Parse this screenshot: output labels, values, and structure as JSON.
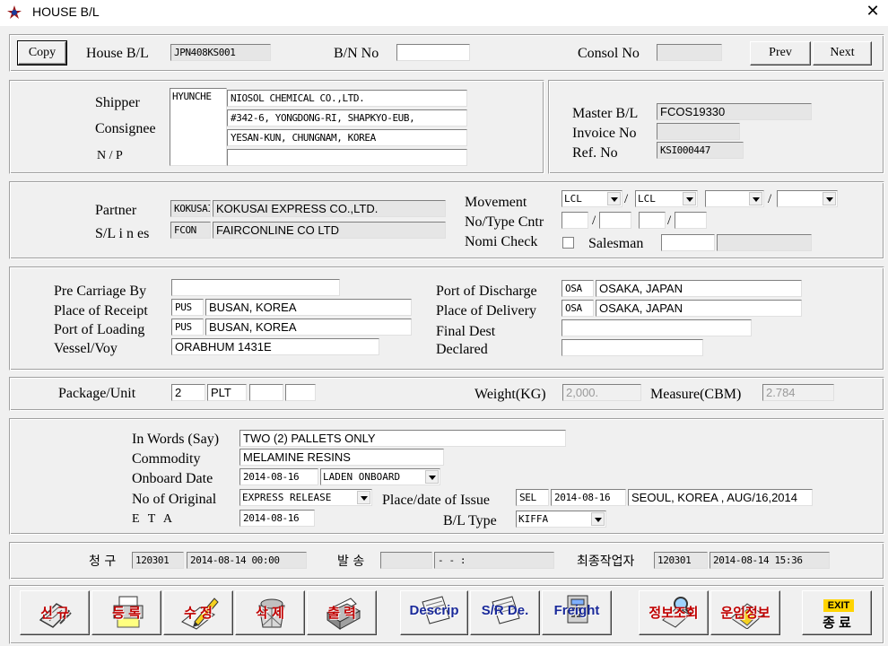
{
  "window": {
    "title": "HOUSE B/L",
    "close_glyph": "✕",
    "app_icon": "app-icon"
  },
  "header": {
    "copy_label": "Copy",
    "house_bl_label": "House B/L",
    "house_bl_value": "JPN408KS001",
    "bn_label": "B/N No",
    "bn_value": "",
    "consol_label": "Consol No",
    "consol_value": "",
    "prev_label": "Prev",
    "next_label": "Next"
  },
  "parties": {
    "shipper_label": "Shipper",
    "consignee_label": "Consignee",
    "np_label": "N / P",
    "shipper_code": "HYUNCHE",
    "lines": [
      "NIOSOL CHEMICAL CO.,LTD.",
      "#342-6, YONGDONG-RI, SHAPKYO-EUB,",
      "YESAN-KUN, CHUNGNAM, KOREA",
      ""
    ],
    "master_bl_label": "Master B/L",
    "master_bl_value": "FCOS19330",
    "invoice_label": "Invoice No",
    "invoice_value": "",
    "ref_label": "Ref. No",
    "ref_value": "KSI000447"
  },
  "partner": {
    "partner_label": "Partner",
    "partner_code": "KOKUSAI",
    "partner_name": "KOKUSAI EXPRESS CO.,LTD.",
    "sl_label": "S/L i n es",
    "sl_code": "FCON",
    "sl_name": "FAIRCONLINE CO LTD",
    "movement_label": "Movement",
    "movement_1": "LCL",
    "movement_2": "LCL",
    "movement_3": "",
    "movement_4": "",
    "sep": "/",
    "cntr_label": "No/Type Cntr",
    "nomi_label": "Nomi Check",
    "salesman_label": "Salesman",
    "salesman_code": "",
    "salesman_name": ""
  },
  "routing": {
    "pre_carriage_label": "Pre Carriage By",
    "pre_carriage_value": "",
    "receipt_label": "Place of Receipt",
    "receipt_code": "PUS",
    "receipt_name": "BUSAN, KOREA",
    "loading_label": "Port of Loading",
    "loading_code": "PUS",
    "loading_name": "BUSAN, KOREA",
    "vessel_label": "Vessel/Voy",
    "vessel_value": "ORABHUM  1431E",
    "discharge_label": "Port of Discharge",
    "discharge_code": "OSA",
    "discharge_name": "OSAKA, JAPAN",
    "delivery_label": "Place of Delivery",
    "delivery_code": "OSA",
    "delivery_name": "OSAKA, JAPAN",
    "final_dest_label": "Final Dest",
    "final_dest_value": "",
    "declared_label": "Declared",
    "declared_value": ""
  },
  "cargo": {
    "package_label": "Package/Unit",
    "package_qty": "2",
    "package_unit": "PLT",
    "package_x1": "",
    "package_x2": "",
    "weight_label": "Weight(KG)",
    "weight_value": "2,000.",
    "measure_label": "Measure(CBM)",
    "measure_value": "2.784"
  },
  "details": {
    "words_label": "In Words (Say)",
    "words_value": "TWO (2) PALLETS ONLY",
    "commodity_label": "Commodity",
    "commodity_value": "MELAMINE RESINS",
    "onboard_label": "Onboard Date",
    "onboard_value": "2014-08-16",
    "onboard_type": "LADEN ONBOARD",
    "original_label": "No of Original",
    "original_value": "EXPRESS RELEASE",
    "issue_label": "Place/date of Issue",
    "issue_code": "SEL",
    "issue_date": "2014-08-16",
    "issue_place": "SEOUL, KOREA , AUG/16,2014",
    "eta_label": "E T A",
    "eta_value": "2014-08-16",
    "bltype_label": "B/L Type",
    "bltype_value": "KIFFA"
  },
  "status": {
    "claim_label": "청 구",
    "claim_code": "120301",
    "claim_time": "2014-08-14 00:00",
    "send_label": "발 송",
    "send_code": "",
    "send_time": " -  -      :",
    "last_label": "최종작업자",
    "last_code": "120301",
    "last_time": "2014-08-14 15:36"
  },
  "toolbar": {
    "new": "신   규",
    "register": "등   록",
    "edit": "수   정",
    "delete": "삭   제",
    "print": "출   력",
    "descrip": "Descrip",
    "sr": "S/R De.",
    "freight": "Freight",
    "info": "정보조회",
    "fare": "운임정보",
    "exit_badge": "EXIT",
    "exit": "종   료"
  }
}
